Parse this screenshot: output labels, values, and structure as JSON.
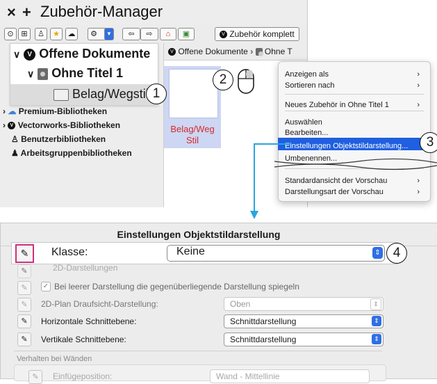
{
  "window": {
    "close_symbol": "×",
    "add_symbol": "+",
    "title": "Zubehör-Manager"
  },
  "toolbar": {
    "complete_label": "Zubehör komplett",
    "icons": [
      "vectorworks-logo-icon",
      "grid-icon",
      "user-icon",
      "star-icon",
      "cloud-icon",
      "gear-icon",
      "chevron-down-icon",
      "back-icon",
      "forward-icon",
      "home-icon",
      "folder-image-icon"
    ]
  },
  "tree": {
    "open_docs": "Offene Dokumente",
    "untitled": "Ohne Titel 1",
    "folder": "Belag/Wegstil",
    "premium": "Premium-Bibliotheken",
    "vectorworks": "Vectorworks-Bibliotheken",
    "user": "Benutzerbibliotheken",
    "workgroup": "Arbeitsgruppenbibliotheken"
  },
  "breadcrumb": {
    "first": "Offene Dokumente",
    "sep": "›",
    "second": "Ohne T"
  },
  "thumbnail": {
    "label_line1": "Belag/Weg",
    "label_line2": "Stil"
  },
  "context_menu": {
    "items": [
      {
        "label": "Anzeigen als",
        "submenu": true
      },
      {
        "label": "Sortieren nach",
        "submenu": true
      },
      {
        "label": "Neues Zubehör in Ohne Titel 1",
        "submenu": true
      },
      {
        "label": "Auswählen",
        "submenu": false
      },
      {
        "label": "Bearbeiten...",
        "submenu": false
      },
      {
        "label": "Einstellungen Objektstildarstellung...",
        "submenu": false,
        "highlighted": true
      },
      {
        "label": "Umbenennen...",
        "submenu": false
      },
      {
        "label": "Standardansicht der Vorschau",
        "submenu": true
      },
      {
        "label": "Darstellungsart der Vorschau",
        "submenu": true
      }
    ],
    "arrow": "›"
  },
  "callouts": [
    "1",
    "2",
    "3",
    "4"
  ],
  "dialog": {
    "title": "Einstellungen Objektstildarstellung",
    "klasse_label": "Klasse:",
    "klasse_value": "Keine",
    "section_2d": "2D-Darstellungen",
    "checkbox_label": "Bei leerer Darstellung die gegenüberliegende Darstellung spiegeln",
    "checkbox_checked": true,
    "plan_label": "2D-Plan Draufsicht-Darstellung:",
    "plan_value": "Oben",
    "horizontal_label": "Horizontale Schnittebene:",
    "horizontal_value": "Schnittdarstellung",
    "vertical_label": "Vertikale Schnittebene:",
    "vertical_value": "Schnittdarstellung",
    "walls_section": "Verhalten bei Wänden",
    "insert_label": "Einfügeposition:",
    "insert_value": "Wand - Mittellinie"
  },
  "colors": {
    "highlight": "#1f5fe0",
    "accent_pink": "#d0307a",
    "label_red": "#d42b2b",
    "connector_blue": "#29a6df"
  }
}
